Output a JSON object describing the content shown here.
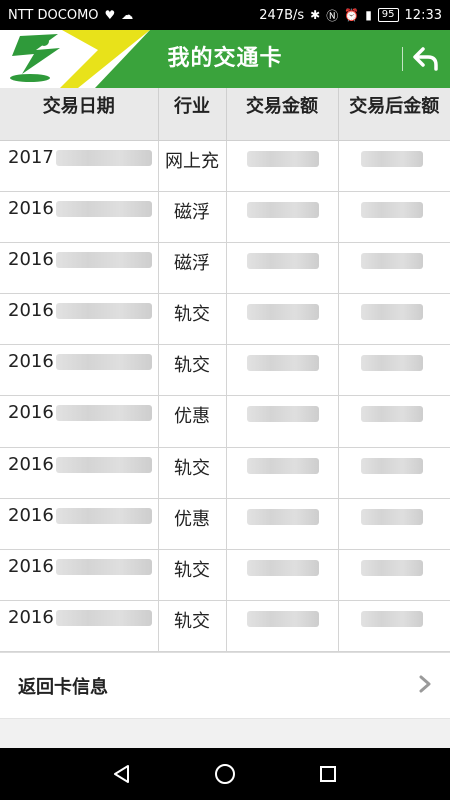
{
  "status_bar": {
    "carrier": "NTT DOCOMO",
    "speed": "247B/s",
    "battery": "95",
    "time": "12:33"
  },
  "header": {
    "title": "我的交通卡"
  },
  "table": {
    "columns": [
      "交易日期",
      "行业",
      "交易金额",
      "交易后金额"
    ],
    "rows": [
      {
        "date": "2017",
        "industry": "网上充"
      },
      {
        "date": "2016",
        "industry": "磁浮"
      },
      {
        "date": "2016",
        "industry": "磁浮"
      },
      {
        "date": "2016",
        "industry": "轨交"
      },
      {
        "date": "2016",
        "industry": "轨交"
      },
      {
        "date": "2016",
        "industry": "优惠"
      },
      {
        "date": "2016",
        "industry": "轨交"
      },
      {
        "date": "2016",
        "industry": "优惠"
      },
      {
        "date": "2016",
        "industry": "轨交"
      },
      {
        "date": "2016",
        "industry": "轨交"
      }
    ]
  },
  "footer": {
    "card_info_label": "返回卡信息"
  },
  "colors": {
    "header_green": "#3aa33c",
    "logo_yellow": "#e8e21a",
    "table_header_bg": "#e9e9e9"
  }
}
